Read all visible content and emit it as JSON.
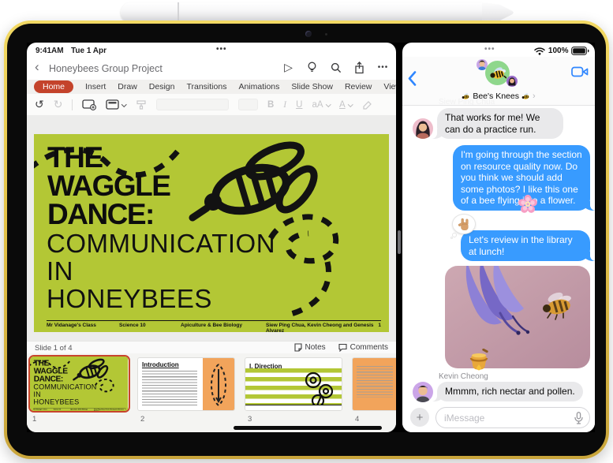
{
  "status": {
    "time": "9:41AM",
    "date": "Tue 1 Apr",
    "battery_pct": "100%"
  },
  "icons": {
    "window_dots": "•••",
    "more": "•••",
    "play": "▷",
    "undo": "↺",
    "redo": "↻",
    "back_chevron": "‹",
    "forward_chevron": "›",
    "plus": "+"
  },
  "powerpoint": {
    "doc_title": "Honeybees Group Project",
    "tabs": [
      {
        "label": "Home"
      },
      {
        "label": "Insert"
      },
      {
        "label": "Draw"
      },
      {
        "label": "Design"
      },
      {
        "label": "Transitions"
      },
      {
        "label": "Animations"
      },
      {
        "label": "Slide Show"
      },
      {
        "label": "Review"
      },
      {
        "label": "View"
      }
    ],
    "active_tab": "Home",
    "ribbon": {
      "bold": "B",
      "italic": "I",
      "underline": "U",
      "text_size": "aA",
      "font_color": "A"
    },
    "slide": {
      "title_lines": [
        "THE",
        "WAGGLE",
        "DANCE:"
      ],
      "subtitle_lines": [
        "COMMUNICATION",
        "IN",
        "HONEYBEES"
      ],
      "footer": {
        "class_name": "Mr Vidanage's Class",
        "course": "Science 10",
        "subject": "Apiculture & Bee Biology",
        "authors": "Siew Ping Chua, Kevin Cheong and Genesis Alvarez",
        "slide_number": "1"
      }
    },
    "status_row": {
      "slide_label": "Slide 1 of 4",
      "notes_label": "Notes",
      "comments_label": "Comments"
    },
    "thumbnails": [
      {
        "number": "1"
      },
      {
        "number": "2",
        "heading": "Introduction"
      },
      {
        "number": "3",
        "heading": "I. Direction"
      },
      {
        "number": "4"
      }
    ]
  },
  "messages": {
    "group_name": "Bee's Knees",
    "sender_top": "Siew Ping Chua",
    "sender_bottom": "Kevin Cheong",
    "bubbles": {
      "received_1": "That works for me! We can do a practice run.",
      "sent_1": "I'm going through the section on resource quality now. Do you think we should add some photos? I like this one of a bee flying into a flower.",
      "sent_2": "Let's review in the library at lunch!",
      "received_2": "Mmmm, rich nectar and pollen."
    },
    "input_placeholder": "iMessage"
  },
  "colors": {
    "accent_orange": "#C4432B",
    "imessage_blue": "#389BFF",
    "slide_green": "#B3C735",
    "ipad_yellow": "#E3C24A",
    "received_gray": "#E9E9EB"
  }
}
